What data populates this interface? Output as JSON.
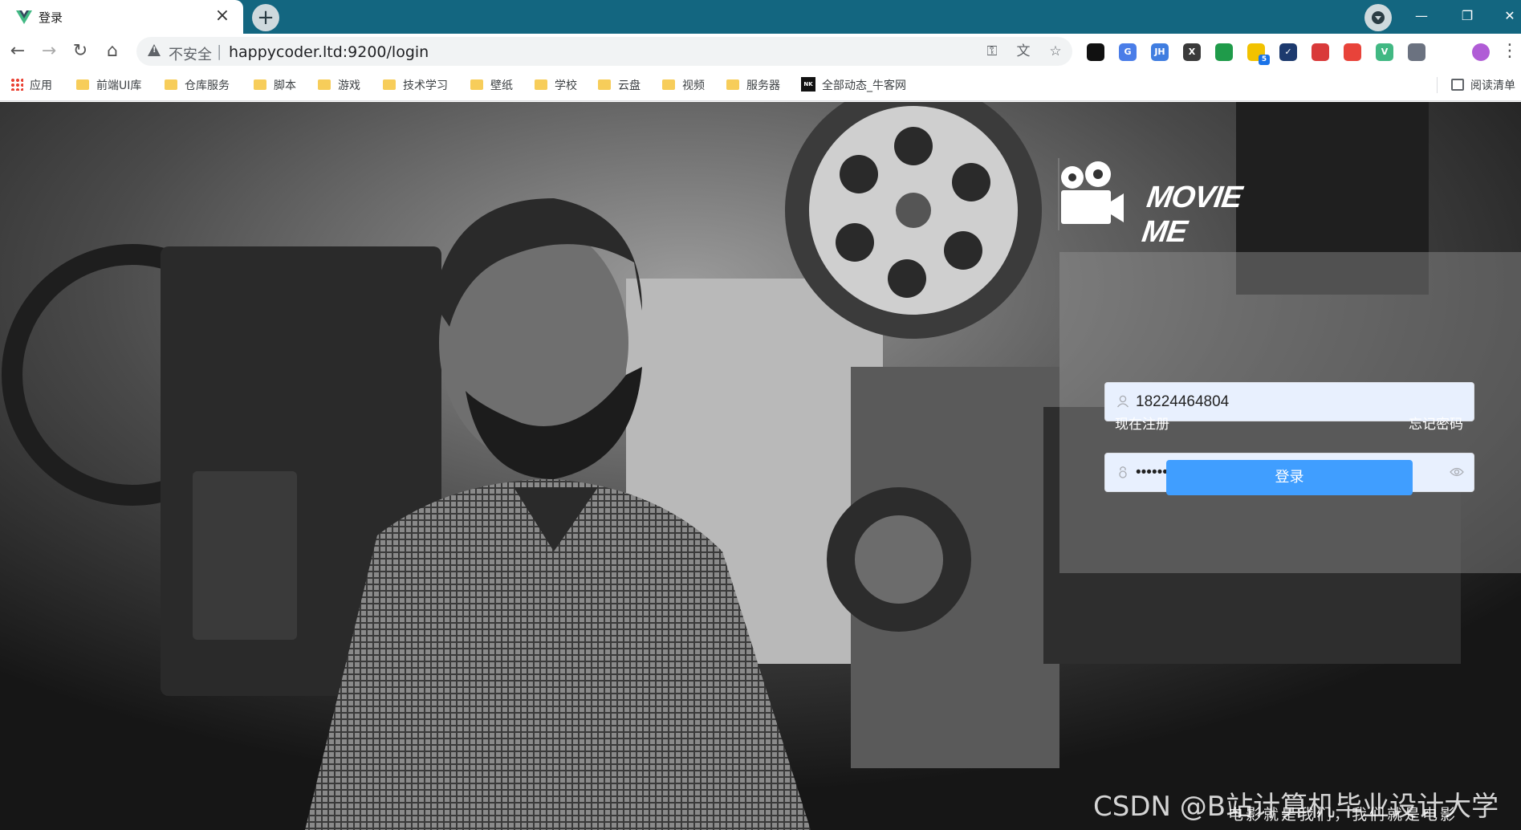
{
  "browser": {
    "tab_title": "登录",
    "tab_close": "×",
    "new_tab": "+",
    "window_controls": {
      "minimize": "—",
      "maximize": "❐",
      "close": "✕"
    },
    "nav": {
      "back": "←",
      "forward": "→",
      "reload": "↻",
      "home": "⌂"
    },
    "address": {
      "security_label": "不安全",
      "separator": "|",
      "url": "happycoder.ltd:9200/login"
    },
    "omnibox_icons": [
      "key-icon",
      "translate-icon",
      "star-icon"
    ],
    "extensions": [
      {
        "name": "ext-1-icon",
        "label": "",
        "color": "#111111"
      },
      {
        "name": "translate-ext-icon",
        "label": "G",
        "color": "#4a7de8"
      },
      {
        "name": "jh-ext-icon",
        "label": "JH",
        "color": "#3f7de0"
      },
      {
        "name": "x-ext-icon",
        "label": "X",
        "color": "#3a3a3a"
      },
      {
        "name": "ext-5-icon",
        "label": "",
        "color": "#1f9b4a"
      },
      {
        "name": "ext-6-icon",
        "label": "",
        "color": "#f2c200",
        "badge": "5"
      },
      {
        "name": "check-ext-icon",
        "label": "✓",
        "color": "#1d3a6e"
      },
      {
        "name": "ext-8-icon",
        "label": "",
        "color": "#d93a3a"
      },
      {
        "name": "ext-9-icon",
        "label": "",
        "color": "#e8433a"
      },
      {
        "name": "vue-ext-icon",
        "label": "V",
        "color": "#41b883"
      },
      {
        "name": "ext-11-icon",
        "label": "",
        "color": "#6b7280"
      },
      {
        "name": "puzzle-ext-icon",
        "label": "",
        "color": "#5f6368"
      },
      {
        "name": "profile-avatar-icon",
        "label": "",
        "color": "#b05cd6"
      }
    ],
    "menu": "⋮"
  },
  "bookmarks": {
    "apps": "应用",
    "items": [
      "前端UI库",
      "仓库服务",
      "脚本",
      "游戏",
      "技术学习",
      "壁纸",
      "学校",
      "云盘",
      "视频",
      "服务器"
    ],
    "nk": "全部动态_牛客网",
    "reading_list": "阅读清单"
  },
  "login": {
    "logo_text": "MOVIE ME",
    "username_value": "18224464804",
    "password_value": "•••••••••",
    "register_link": "现在注册",
    "forgot_link": "忘记密码",
    "submit_label": "登录",
    "slogan": "电影就是我们，我们就是电影"
  },
  "watermark": "CSDN @B站计算机毕业设计大学",
  "colors": {
    "tabstrip": "#136680",
    "primary_button": "#409eff",
    "input_fill": "#e8f0fe"
  }
}
